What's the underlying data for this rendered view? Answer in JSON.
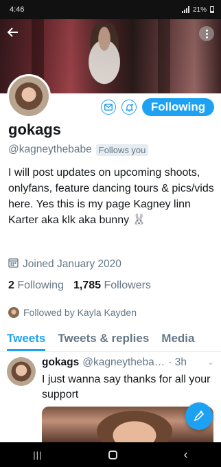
{
  "status_bar": {
    "time": "4:46",
    "battery": "21%"
  },
  "profile": {
    "display_name": "gokags",
    "handle": "@kagneythebabe",
    "follows_you_badge": "Follows you",
    "bio": "I will post updates on upcoming shoots, onlyfans, feature dancing tours & pics/vids here. Yes this is my page Kagney linn Karter aka klk aka bunny 🐰",
    "joined": "Joined January 2020",
    "following_count": "2",
    "following_label": "Following",
    "followers_count": "1,785",
    "followers_label": "Followers",
    "followed_by": "Followed by Kayla Kayden",
    "follow_button_label": "Following"
  },
  "tabs": [
    {
      "label": "Tweets",
      "active": true
    },
    {
      "label": "Tweets & replies"
    },
    {
      "label": "Media"
    }
  ],
  "tweet": {
    "name": "gokags",
    "handle": "@kagneytheba…",
    "time": "· 3h",
    "text": "I just wanna say thanks for all your support"
  },
  "colors": {
    "accent": "#1da1f2",
    "secondary_text": "#657786"
  },
  "icons": [
    "back-arrow-icon",
    "more-icon",
    "mail-icon",
    "bell-plus-icon",
    "calendar-icon",
    "compose-icon"
  ]
}
